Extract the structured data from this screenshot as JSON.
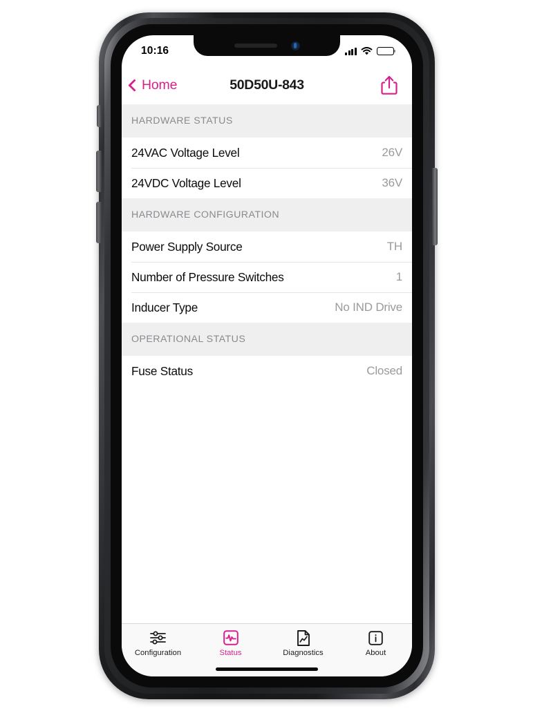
{
  "status_bar": {
    "time": "10:16",
    "signal_icon": "cellular-signal-icon",
    "wifi_icon": "wifi-icon",
    "battery_icon": "battery-full-icon"
  },
  "nav": {
    "back_label": "Home",
    "title": "50D50U-843",
    "back_icon": "chevron-left-icon",
    "share_icon": "share-icon"
  },
  "sections": [
    {
      "header": "HARDWARE STATUS",
      "rows": [
        {
          "label": "24VAC Voltage Level",
          "value": "26V"
        },
        {
          "label": "24VDC Voltage Level",
          "value": "36V"
        }
      ]
    },
    {
      "header": "HARDWARE CONFIGURATION",
      "rows": [
        {
          "label": "Power Supply Source",
          "value": "TH"
        },
        {
          "label": "Number of Pressure Switches",
          "value": "1"
        },
        {
          "label": "Inducer Type",
          "value": "No IND Drive"
        }
      ]
    },
    {
      "header": "OPERATIONAL STATUS",
      "rows": [
        {
          "label": "Fuse Status",
          "value": "Closed"
        }
      ]
    }
  ],
  "tabs": [
    {
      "label": "Configuration",
      "icon": "sliders-icon",
      "active": false
    },
    {
      "label": "Status",
      "icon": "pulse-waveform-icon",
      "active": true
    },
    {
      "label": "Diagnostics",
      "icon": "document-chart-icon",
      "active": false
    },
    {
      "label": "About",
      "icon": "info-square-icon",
      "active": false
    }
  ],
  "colors": {
    "accent": "#D6218C",
    "section_header_bg": "#EFEFF0",
    "section_header_text": "#8A8A8E",
    "row_value_text": "#9A9A9E",
    "tab_bar_bg": "#F9F9F9",
    "separator": "#E4E4E6"
  }
}
